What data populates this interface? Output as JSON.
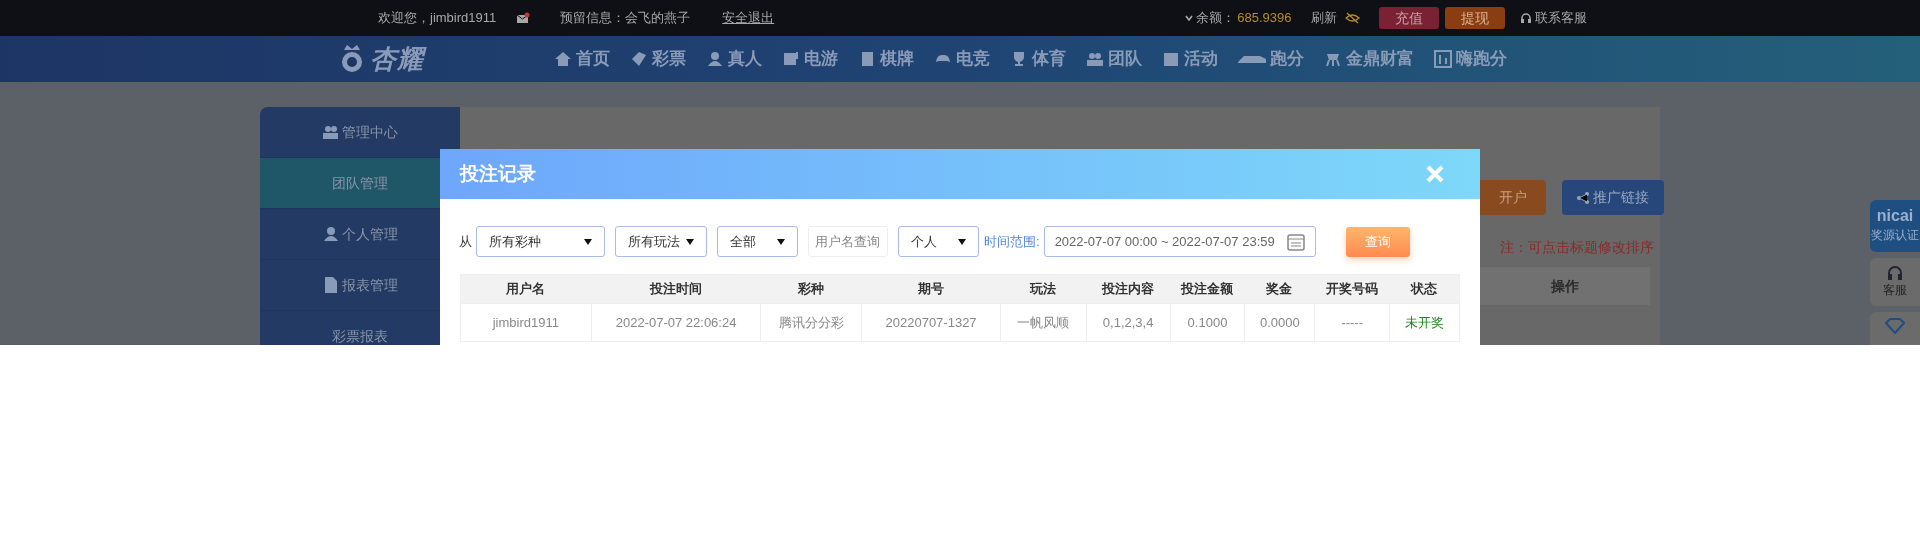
{
  "top_bar": {
    "greeting": "欢迎您，jimbird1911",
    "has_message": true,
    "notice": "预留信息：会飞的燕子",
    "logout": "安全退出",
    "balance_label": "余额：",
    "balance": "685.9396",
    "refresh": "刷新",
    "buttons": [
      {
        "label": "充值",
        "kind": "deposit"
      },
      {
        "label": "提现",
        "kind": "withdraw"
      }
    ],
    "service": "联系客服"
  },
  "nav": {
    "logo": "杏耀",
    "items": [
      {
        "label": "首页"
      },
      {
        "label": "彩票"
      },
      {
        "label": "真人"
      },
      {
        "label": "电游"
      },
      {
        "label": "棋牌"
      },
      {
        "label": "电竞"
      },
      {
        "label": "体育"
      },
      {
        "label": "团队"
      },
      {
        "label": "活动"
      },
      {
        "label": "跑分"
      },
      {
        "label": "金鼎财富"
      },
      {
        "label": "嗨跑分"
      }
    ]
  },
  "sidebar": {
    "items": [
      {
        "label": "管理中心",
        "kind": "heading",
        "selected": false
      },
      {
        "label": "团队管理",
        "kind": "sub",
        "selected": true
      },
      {
        "label": "个人管理",
        "kind": "heading",
        "selected": false
      },
      {
        "label": "报表管理",
        "kind": "heading",
        "selected": false
      },
      {
        "label": "彩票报表",
        "kind": "sub",
        "selected": false
      }
    ]
  },
  "background": {
    "buttons": [
      {
        "label": "开户",
        "kind": "orange"
      },
      {
        "label": "推广链接",
        "kind": "blue"
      }
    ],
    "note": "注：可点击标题修改排序",
    "column": "操作"
  },
  "float_bar": [
    {
      "kind": "badge",
      "title": "nicai",
      "label": "奖源认证"
    },
    {
      "kind": "headset",
      "label": "客服"
    },
    {
      "kind": "diamond"
    }
  ],
  "modal": {
    "title": "投注记录",
    "from_label": "从",
    "selects": [
      {
        "value": "所有彩种"
      },
      {
        "value": "所有玩法"
      },
      {
        "value": "全部"
      }
    ],
    "username": {
      "placeholder": "用户名查询"
    },
    "scope": "个人",
    "time_label": "时间范围:",
    "time_range": "2022-07-07 00:00 ~ 2022-07-07 23:59",
    "query": "查询",
    "columns": [
      "用户名",
      "投注时间",
      "彩种",
      "期号",
      "玩法",
      "投注内容",
      "投注金额",
      "奖金",
      "开奖号码",
      "状态"
    ],
    "rows": [
      {
        "cells": [
          "jimbird1911",
          "2022-07-07 22:06:24",
          "腾讯分分彩",
          "20220707-1327",
          "一帆风顺",
          "0,1,2,3,4",
          "0.1000",
          "0.0000",
          "-----",
          "未开奖"
        ],
        "color": "#1a8a1a"
      }
    ]
  }
}
